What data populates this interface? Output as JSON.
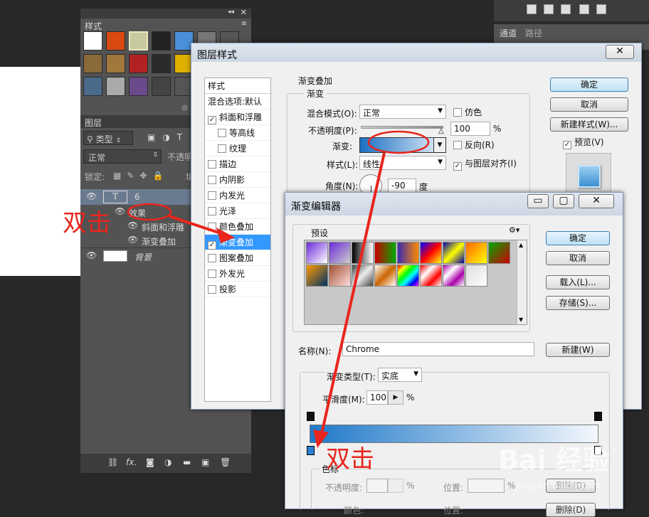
{
  "styles_panel": {
    "title": "样式"
  },
  "layers_panel": {
    "title": "图层",
    "filter_label": "类型",
    "blend_mode": "正常",
    "opacity_label": "不透明",
    "lock_label": "锁定:",
    "fill_label": "填",
    "layers": [
      {
        "name": "6",
        "kind": "text"
      },
      {
        "name": "效果",
        "kind": "effects"
      },
      {
        "name": "斜面和浮雕",
        "kind": "effect"
      },
      {
        "name": "渐变叠加",
        "kind": "effect"
      },
      {
        "name": "背景",
        "kind": "background"
      }
    ],
    "bottom_fx": "fx."
  },
  "right_panel": {
    "tabs": [
      "通道",
      "路径"
    ]
  },
  "layer_style": {
    "title": "图层样式",
    "list_header": "样式",
    "items": [
      {
        "label": "混合选项:默认",
        "checkbox": false,
        "checked": false,
        "indent": false,
        "selected": false
      },
      {
        "label": "斜面和浮雕",
        "checkbox": true,
        "checked": true,
        "indent": false,
        "selected": false
      },
      {
        "label": "等高线",
        "checkbox": true,
        "checked": false,
        "indent": true,
        "selected": false
      },
      {
        "label": "纹理",
        "checkbox": true,
        "checked": false,
        "indent": true,
        "selected": false
      },
      {
        "label": "描边",
        "checkbox": true,
        "checked": false,
        "indent": false,
        "selected": false
      },
      {
        "label": "内阴影",
        "checkbox": true,
        "checked": false,
        "indent": false,
        "selected": false
      },
      {
        "label": "内发光",
        "checkbox": true,
        "checked": false,
        "indent": false,
        "selected": false
      },
      {
        "label": "光泽",
        "checkbox": true,
        "checked": false,
        "indent": false,
        "selected": false
      },
      {
        "label": "颜色叠加",
        "checkbox": true,
        "checked": false,
        "indent": false,
        "selected": false
      },
      {
        "label": "渐变叠加",
        "checkbox": true,
        "checked": true,
        "indent": false,
        "selected": true
      },
      {
        "label": "图案叠加",
        "checkbox": true,
        "checked": false,
        "indent": false,
        "selected": false
      },
      {
        "label": "外发光",
        "checkbox": true,
        "checked": false,
        "indent": false,
        "selected": false
      },
      {
        "label": "投影",
        "checkbox": true,
        "checked": false,
        "indent": false,
        "selected": false
      }
    ],
    "section_title": "渐变叠加",
    "group_title": "渐变",
    "blend_label": "混合模式(O):",
    "blend_value": "正常",
    "dither_label": "仿色",
    "opacity_label": "不透明度(P):",
    "opacity_value": "100",
    "percent": "%",
    "gradient_label": "渐变:",
    "reverse_label": "反向(R)",
    "style_label": "样式(L):",
    "style_value": "线性",
    "align_label": "与图层对齐(I)",
    "angle_label": "角度(N):",
    "angle_value": "-90",
    "degree": "度",
    "ok": "确定",
    "cancel": "取消",
    "new_style": "新建样式(W)...",
    "preview": "预览(V)"
  },
  "gradient_editor": {
    "title": "渐变编辑器",
    "presets_label": "预设",
    "ok": "确定",
    "cancel": "取消",
    "load": "载入(L)...",
    "save": "存储(S)...",
    "name_label": "名称(N):",
    "name_value": "Chrome",
    "new_button": "新建(W)",
    "type_label": "渐变类型(T):",
    "type_value": "实底",
    "smooth_label": "平滑度(M):",
    "smooth_value": "100",
    "percent": "%",
    "stops_title": "色标",
    "stop_opacity_label": "不透明度:",
    "stop_position_label": "位置:",
    "stop_color_label": "颜色:",
    "delete_button": "删除(D)"
  },
  "annotations": {
    "double_click_1": "双击",
    "double_click_2": "双击"
  },
  "watermark": {
    "text": "Bai 经验",
    "url": "jingyan.baidu.com"
  }
}
